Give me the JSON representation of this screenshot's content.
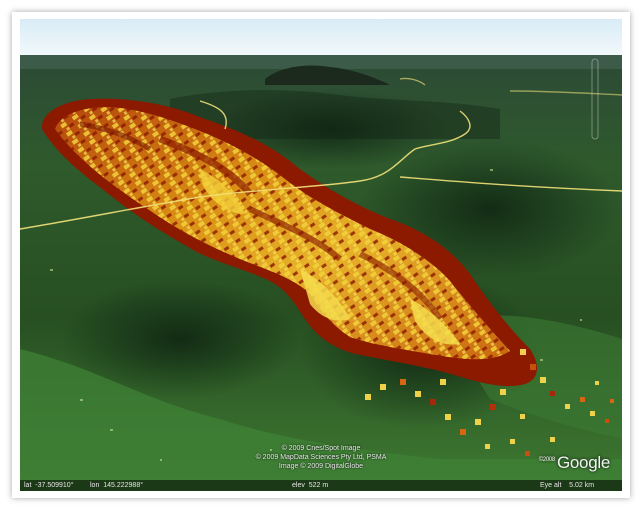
{
  "map": {
    "credits": [
      "© 2009 Cnes/Spot Image",
      "© 2009 MapData Sciences Pty Ltd, PSMA",
      "Image © 2009 DigitalGlobe"
    ],
    "logo_prefix": "©2008",
    "logo": "Google",
    "status": {
      "lat": "lat  -37.509910°",
      "lon": "lon  145.222988°",
      "elev": "elev  522 m",
      "eye_alt": "Eye alt    5.02 km"
    },
    "colors": {
      "sky": "#dfeff7",
      "terrain": "#2c5a2a",
      "burn_dark": "#8b1a00",
      "burn_mid": "#d4880a",
      "burn_light": "#f0d24a",
      "road": "#f2e27a"
    }
  }
}
